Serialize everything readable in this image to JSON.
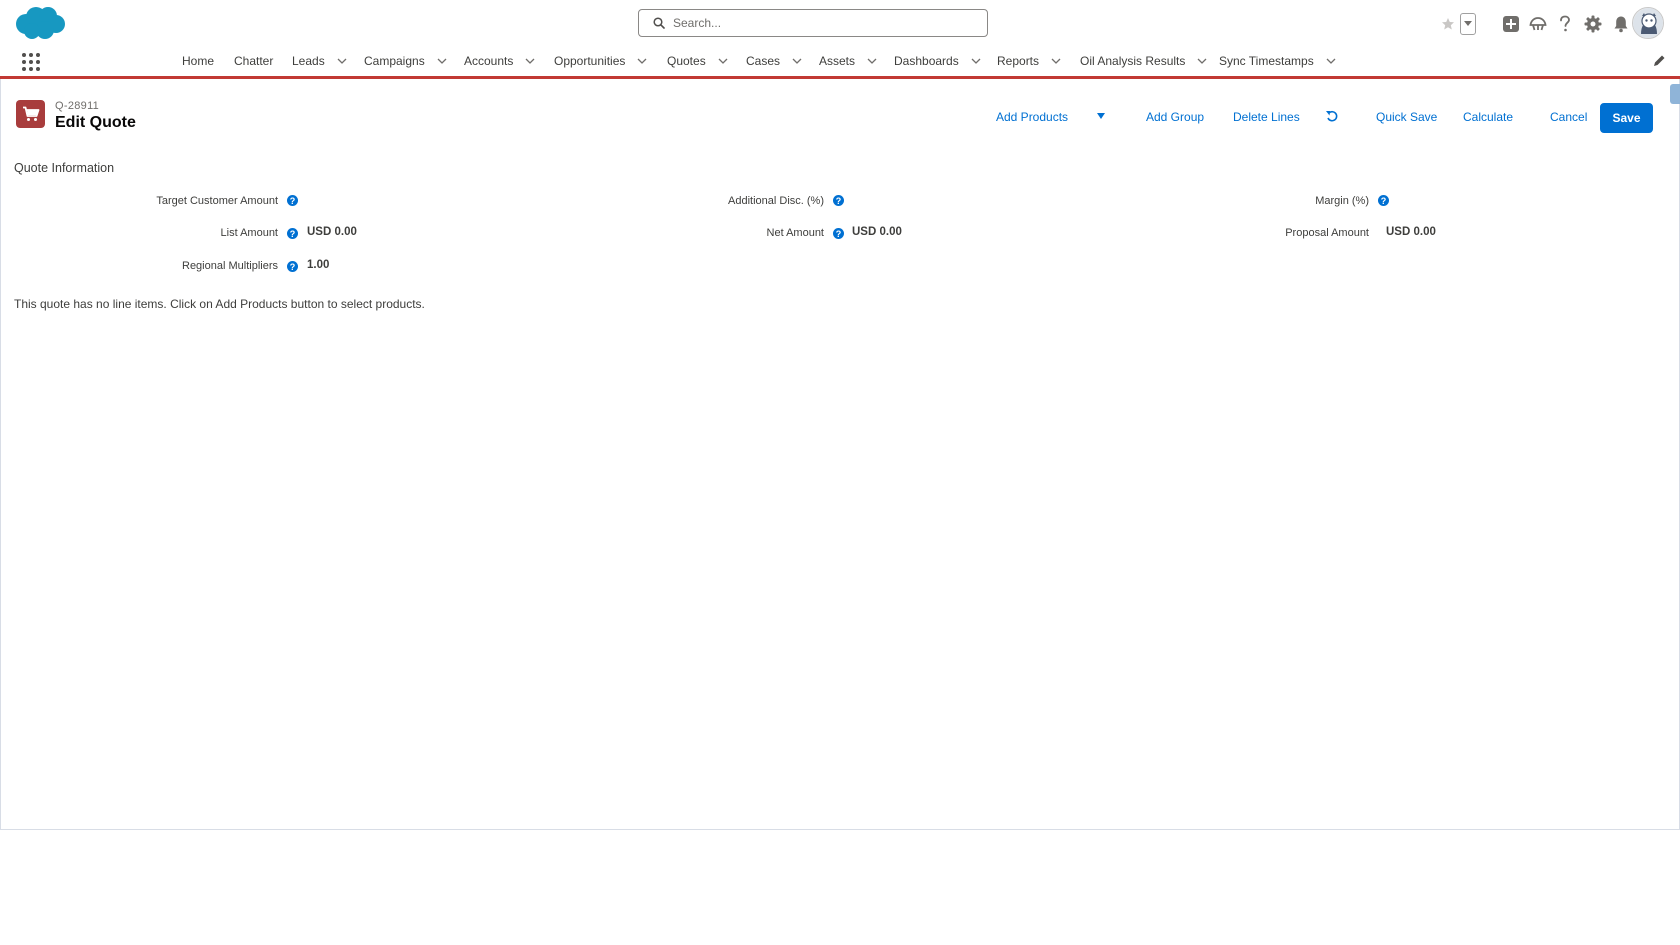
{
  "search": {
    "placeholder": "Search..."
  },
  "nav": {
    "items": [
      {
        "label": "Home",
        "has_menu": false
      },
      {
        "label": "Chatter",
        "has_menu": false
      },
      {
        "label": "Leads",
        "has_menu": true
      },
      {
        "label": "Campaigns",
        "has_menu": true
      },
      {
        "label": "Accounts",
        "has_menu": true
      },
      {
        "label": "Opportunities",
        "has_menu": true
      },
      {
        "label": "Quotes",
        "has_menu": true
      },
      {
        "label": "Cases",
        "has_menu": true
      },
      {
        "label": "Assets",
        "has_menu": true
      },
      {
        "label": "Dashboards",
        "has_menu": true
      },
      {
        "label": "Reports",
        "has_menu": true
      },
      {
        "label": "Oil Analysis Results",
        "has_menu": true
      },
      {
        "label": "Sync Timestamps",
        "has_menu": true
      }
    ]
  },
  "page_header": {
    "record_number": "Q-28911",
    "title": "Edit Quote"
  },
  "actions": {
    "add_products": "Add Products",
    "add_group": "Add Group",
    "delete_lines": "Delete Lines",
    "quick_save": "Quick Save",
    "calculate": "Calculate",
    "cancel": "Cancel",
    "save": "Save"
  },
  "quote_info": {
    "section_title": "Quote Information",
    "fields": {
      "target_customer_amount": {
        "label": "Target Customer Amount",
        "value": ""
      },
      "list_amount": {
        "label": "List Amount",
        "value": "USD 0.00"
      },
      "regional_multipliers": {
        "label": "Regional Multipliers",
        "value": "1.00"
      },
      "additional_disc": {
        "label": "Additional Disc. (%)",
        "value": ""
      },
      "net_amount": {
        "label": "Net Amount",
        "value": "USD 0.00"
      },
      "margin": {
        "label": "Margin (%)",
        "value": ""
      },
      "proposal_amount": {
        "label": "Proposal Amount",
        "value": "USD 0.00"
      }
    }
  },
  "empty_message": "This quote has no line items. Click on Add Products button to select products.",
  "colors": {
    "brand_blue": "#0070d2",
    "nav_accent_red": "#c23934",
    "record_icon": "#a83c3c",
    "logo_blue": "#1798c1"
  },
  "icons": {
    "logo": "salesforce-cloud-logo",
    "search": "search-icon",
    "favorites": "star-icon",
    "global_actions": "plus-square-icon",
    "trailhead": "trailhead-icon",
    "help": "question-icon",
    "setup": "gear-icon",
    "notifications": "bell-icon",
    "record": "cart-icon"
  }
}
